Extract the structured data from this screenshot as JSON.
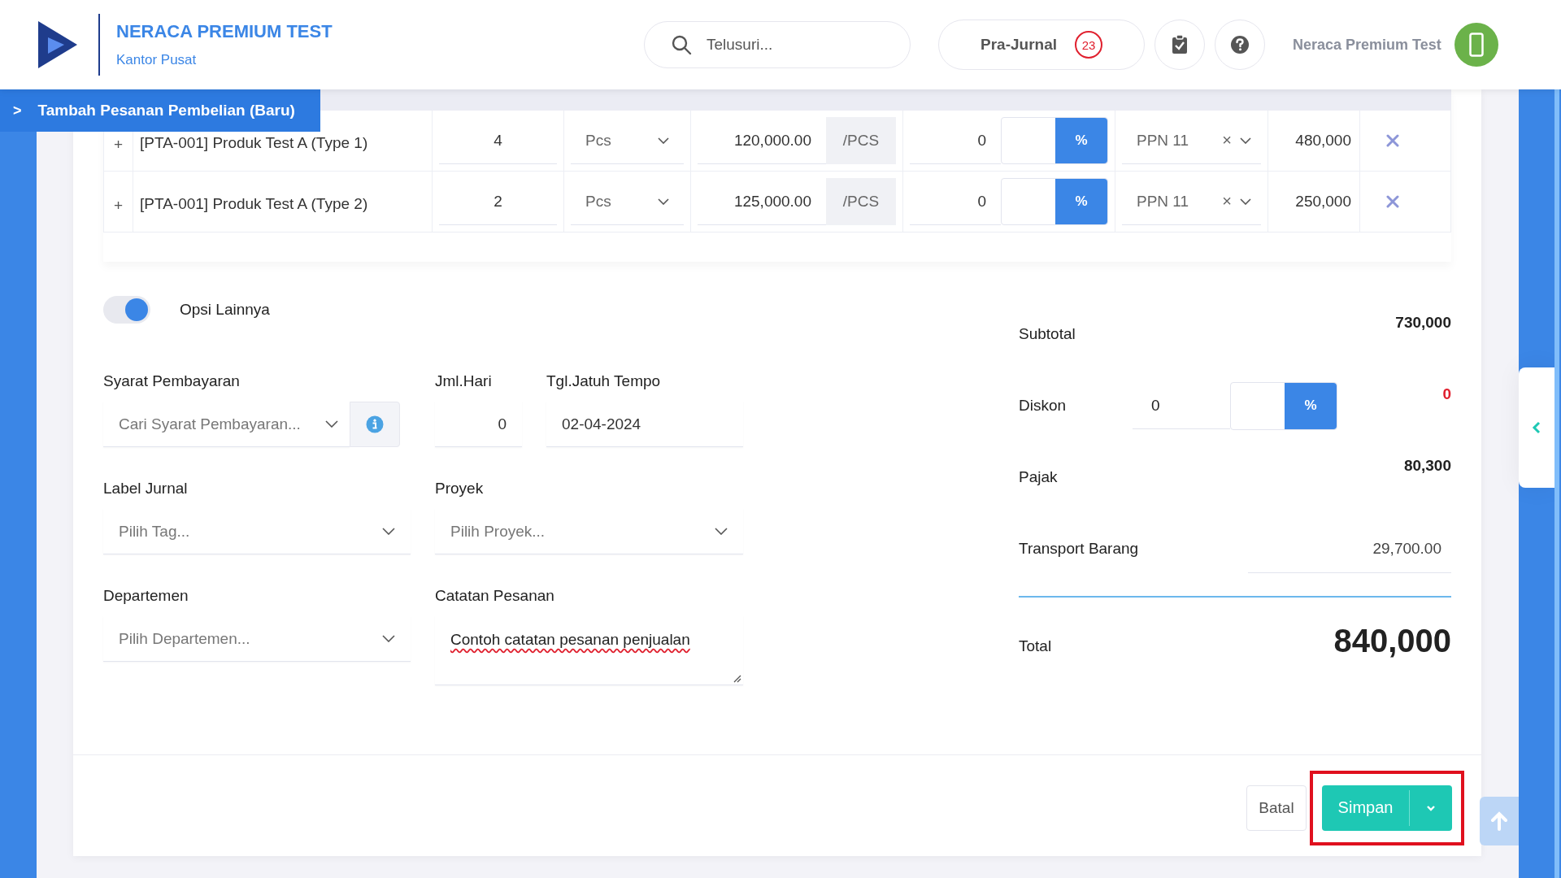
{
  "header": {
    "company": "NERACA PREMIUM TEST",
    "branch": "Kantor Pusat",
    "search": {
      "placeholder": "Telusuri..."
    },
    "pre_journal": {
      "label": "Pra-Jurnal",
      "count": "23"
    },
    "user": "Neraca Premium Test"
  },
  "page_title": {
    "chevron": ">",
    "text": "Tambah Pesanan Pembelian (Baru)"
  },
  "items": [
    {
      "expand": "+",
      "product": "[PTA-001] Produk Test A (Type 1)",
      "qty": "4",
      "unit": "Pcs",
      "price": "120,000.00",
      "per": "/PCS",
      "discount": "0",
      "discount_unit": "%",
      "tax": "PPN 11",
      "clear": "×",
      "amount": "480,000"
    },
    {
      "expand": "+",
      "product": "[PTA-001] Produk Test A (Type 2)",
      "qty": "2",
      "unit": "Pcs",
      "price": "125,000.00",
      "per": "/PCS",
      "discount": "0",
      "discount_unit": "%",
      "tax": "PPN 11",
      "clear": "×",
      "amount": "250,000"
    }
  ],
  "options_toggle": {
    "label": "Opsi Lainnya",
    "on": true
  },
  "form": {
    "payment_terms": {
      "label": "Syarat Pembayaran",
      "placeholder": "Cari Syarat Pembayaran..."
    },
    "days": {
      "label": "Jml.Hari",
      "value": "0"
    },
    "due_date": {
      "label": "Tgl.Jatuh Tempo",
      "value": "02-04-2024"
    },
    "journal_label": {
      "label": "Label Jurnal",
      "placeholder": "Pilih Tag..."
    },
    "project": {
      "label": "Proyek",
      "placeholder": "Pilih Proyek..."
    },
    "department": {
      "label": "Departemen",
      "placeholder": "Pilih Departemen..."
    },
    "notes": {
      "label": "Catatan Pesanan",
      "value": "Contoh catatan pesanan penjualan"
    }
  },
  "summary": {
    "subtotal": {
      "label": "Subtotal",
      "value": "730,000"
    },
    "discount": {
      "label": "Diskon",
      "value": "0",
      "unit": "%",
      "amount": "0"
    },
    "tax": {
      "label": "Pajak",
      "value": "80,300"
    },
    "transport": {
      "label": "Transport Barang",
      "value": "29,700.00"
    },
    "total": {
      "label": "Total",
      "value": "840,000"
    }
  },
  "actions": {
    "cancel": "Batal",
    "save": "Simpan"
  }
}
